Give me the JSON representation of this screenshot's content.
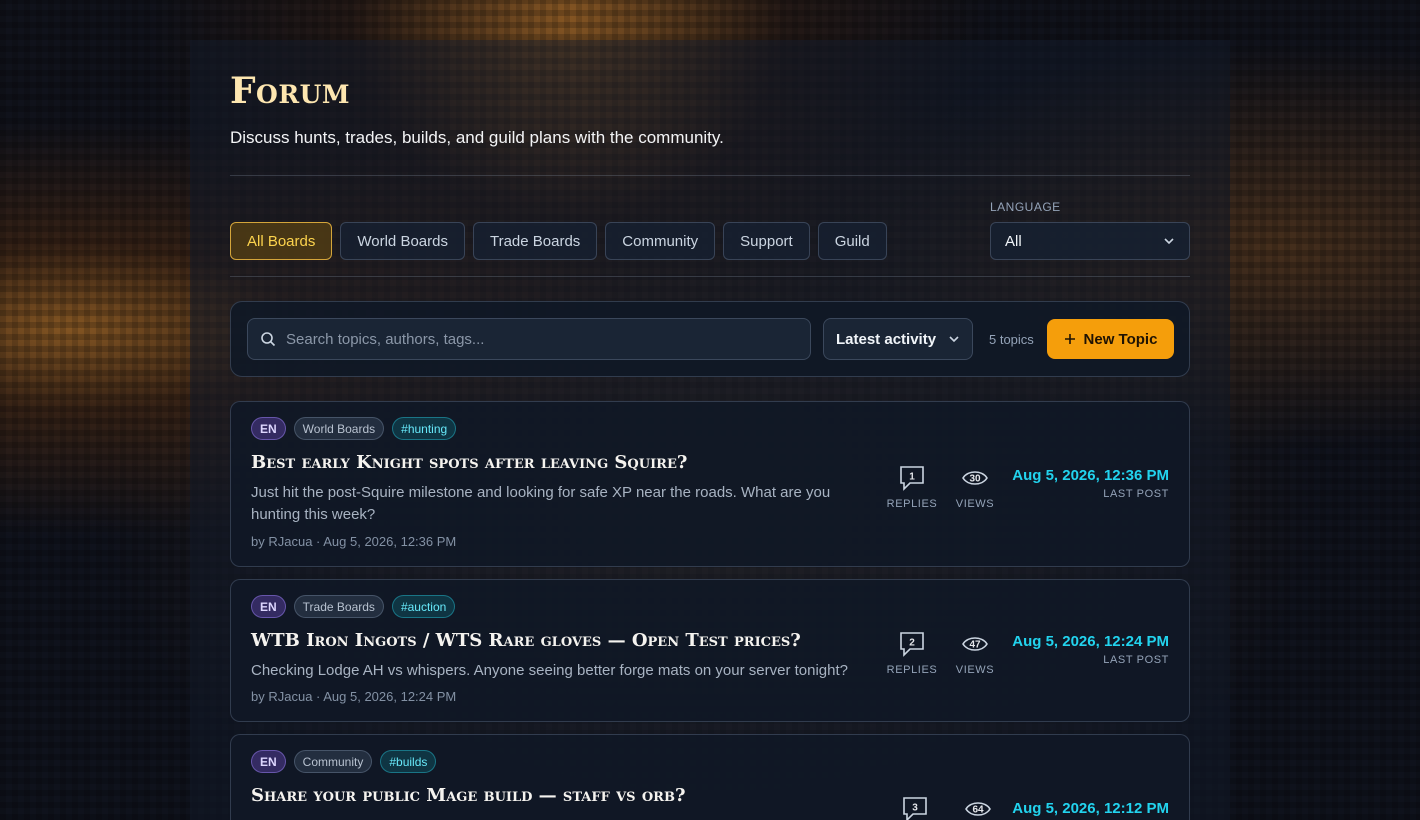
{
  "header": {
    "title": "Forum",
    "subtitle": "Discuss hunts, trades, builds, and guild plans with the community."
  },
  "tabs": [
    {
      "label": "All Boards",
      "active": true
    },
    {
      "label": "World Boards",
      "active": false
    },
    {
      "label": "Trade Boards",
      "active": false
    },
    {
      "label": "Community",
      "active": false
    },
    {
      "label": "Support",
      "active": false
    },
    {
      "label": "Guild",
      "active": false
    }
  ],
  "language": {
    "label": "LANGUAGE",
    "selected": "All"
  },
  "toolbar": {
    "search_placeholder": "Search topics, authors, tags...",
    "sort_selected": "Latest activity",
    "topic_count": "5 topics",
    "new_topic_label": "New Topic",
    "icons": {
      "search": "search-icon",
      "sort": "chevron-down-icon",
      "new": "plus-icon"
    }
  },
  "labels": {
    "replies": "REPLIES",
    "views": "VIEWS",
    "last_post": "LAST POST"
  },
  "colors": {
    "accent": "#f59e0b",
    "date": "#22d3ee",
    "title": "#fde6b0"
  },
  "topics": [
    {
      "lang": "EN",
      "board": "World Boards",
      "tag": "#hunting",
      "title": "Best early Knight spots after leaving Squire?",
      "excerpt": "Just hit the post-Squire milestone and looking for safe XP near the roads. What are you hunting this week?",
      "meta": "by RJacua · Aug 5, 2026, 12:36 PM",
      "replies": "1",
      "views": "30",
      "last_post": "Aug 5, 2026, 12:36 PM"
    },
    {
      "lang": "EN",
      "board": "Trade Boards",
      "tag": "#auction",
      "title": "WTB Iron Ingots / WTS Rare gloves — Open Test prices?",
      "excerpt": "Checking Lodge AH vs whispers. Anyone seeing better forge mats on your server tonight?",
      "meta": "by RJacua · Aug 5, 2026, 12:24 PM",
      "replies": "2",
      "views": "47",
      "last_post": "Aug 5, 2026, 12:24 PM"
    },
    {
      "lang": "EN",
      "board": "Community",
      "tag": "#builds",
      "title": "Share your public Mage build — staff vs orb?",
      "excerpt": "",
      "meta": "",
      "replies": "3",
      "views": "64",
      "last_post": "Aug 5, 2026, 12:12 PM"
    }
  ]
}
